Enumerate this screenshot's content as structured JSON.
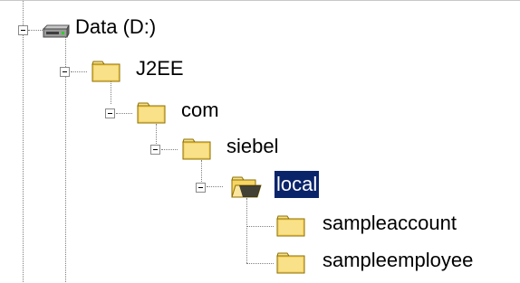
{
  "tree": {
    "nodes": [
      {
        "label": "Data (D:)",
        "icon": "drive-icon",
        "expanded": true
      },
      {
        "label": "J2EE",
        "icon": "folder-closed-icon",
        "expanded": true
      },
      {
        "label": "com",
        "icon": "folder-closed-icon",
        "expanded": true
      },
      {
        "label": "siebel",
        "icon": "folder-closed-icon",
        "expanded": true
      },
      {
        "label": "local",
        "icon": "folder-open-icon",
        "expanded": true,
        "selected": true
      },
      {
        "label": "sampleaccount",
        "icon": "folder-closed-icon"
      },
      {
        "label": "sampleemployee",
        "icon": "folder-closed-icon"
      }
    ]
  },
  "colors": {
    "selection_background": "#0a246a",
    "selection_text": "#ffffff",
    "folder_yellow": "#f6d565",
    "connector_lines": "#808080"
  }
}
